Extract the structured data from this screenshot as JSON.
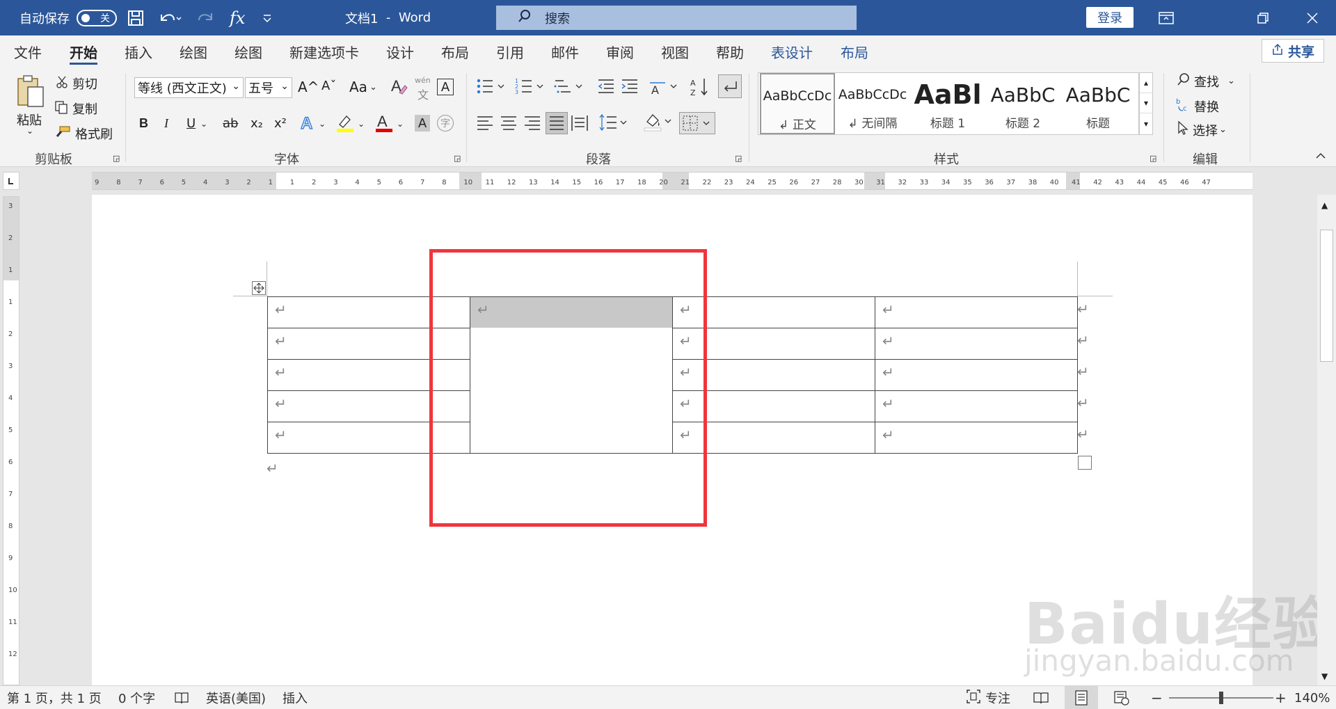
{
  "titlebar": {
    "autosave_label": "自动保存",
    "autosave_state": "关",
    "doc_name": "文档1",
    "separator": "-",
    "app_name": "Word",
    "search_placeholder": "搜索",
    "login_label": "登录"
  },
  "tabs": [
    "文件",
    "开始",
    "插入",
    "绘图",
    "绘图",
    "新建选项卡",
    "设计",
    "布局",
    "引用",
    "邮件",
    "审阅",
    "视图",
    "帮助",
    "表设计",
    "布局"
  ],
  "share_label": "共享",
  "clipboard": {
    "paste": "粘贴",
    "cut": "剪切",
    "copy": "复制",
    "format_painter": "格式刷",
    "group": "剪贴板"
  },
  "font": {
    "name": "等线 (西文正文)",
    "size": "五号",
    "change_case": "Aa",
    "group": "字体",
    "bold": "B",
    "italic": "I",
    "underline": "U",
    "strike": "ab",
    "subscript": "x₂",
    "superscript": "x²",
    "wen": "wén",
    "grow": "A^",
    "shrink": "Aˇ",
    "char_border": "A",
    "char_shade": "A",
    "circle": "字"
  },
  "paragraph": {
    "group": "段落"
  },
  "styles": {
    "group": "样式",
    "items": [
      {
        "sample": "AaBbCcDc",
        "name": "↲ 正文"
      },
      {
        "sample": "AaBbCcDc",
        "name": "↲ 无间隔"
      },
      {
        "sample": "AaBl",
        "name": "标题 1"
      },
      {
        "sample": "AaBbC",
        "name": "标题 2"
      },
      {
        "sample": "AaBbC",
        "name": "标题"
      }
    ]
  },
  "editing": {
    "find": "查找",
    "replace": "替换",
    "select": "选择",
    "group": "编辑"
  },
  "ruler_numbers": [
    "9",
    "8",
    "7",
    "6",
    "5",
    "4",
    "3",
    "2",
    "1",
    "1",
    "2",
    "3",
    "4",
    "5",
    "6",
    "7",
    "8",
    "10",
    "11",
    "12",
    "13",
    "14",
    "15",
    "16",
    "17",
    "18",
    "20",
    "21",
    "22",
    "23",
    "24",
    "25",
    "26",
    "27",
    "28",
    "30",
    "31",
    "32",
    "33",
    "34",
    "35",
    "36",
    "37",
    "38",
    "40",
    "41",
    "42",
    "43",
    "44",
    "45",
    "46",
    "47"
  ],
  "vruler_numbers": [
    "3",
    "2",
    "1",
    "1",
    "2",
    "3",
    "4",
    "5",
    "6",
    "7",
    "8",
    "9",
    "10",
    "11",
    "12"
  ],
  "table": {
    "mark": "↵",
    "rows": 5
  },
  "status": {
    "page": "第 1 页，共 1 页",
    "words": "0 个字",
    "language": "英语(美国)",
    "mode": "插入",
    "focus": "专注",
    "zoom": "140%",
    "zoom_minus": "−",
    "zoom_plus": "+"
  },
  "watermark": {
    "brand": "Baidu经验",
    "url": "jingyan.baidu.com"
  },
  "colors": {
    "titlebar": "#2b579a",
    "highlight": "#f0353d",
    "cell_selected": "#c8c8c8"
  }
}
